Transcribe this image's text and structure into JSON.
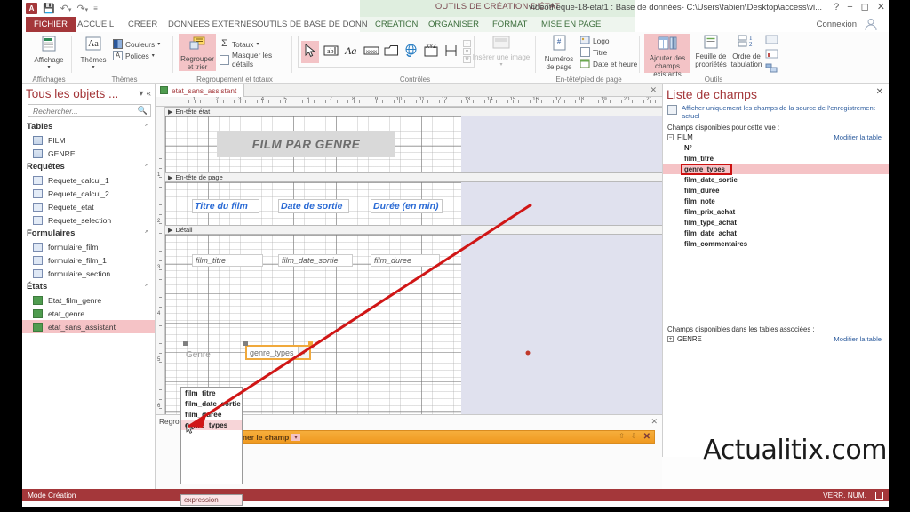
{
  "titlebar": {
    "app_icon": "access-logo",
    "qat": [
      "save-icon",
      "undo-icon",
      "redo-icon",
      "customize-qat-icon"
    ],
    "context_tab_label": "OUTILS DE CRÉATION D'ÉTAT",
    "document_title": "videotheque-18-etat1 : Base de données- C:\\Users\\fabien\\Desktop\\access\\vi...",
    "help": "?",
    "minimize": "−",
    "restore": "◻",
    "close": "✕",
    "account_label": "Connexion"
  },
  "ribbon_tabs": [
    {
      "label": "FICHIER",
      "state": "file"
    },
    {
      "label": "ACCUEIL",
      "state": "normal"
    },
    {
      "label": "CRÉER",
      "state": "normal"
    },
    {
      "label": "DONNÉES EXTERNES",
      "state": "normal"
    },
    {
      "label": "OUTILS DE BASE DE DONNÉES",
      "state": "normal"
    },
    {
      "label": "CRÉATION",
      "state": "active"
    },
    {
      "label": "ORGANISER",
      "state": "context"
    },
    {
      "label": "FORMAT",
      "state": "context"
    },
    {
      "label": "MISE EN PAGE",
      "state": "context"
    }
  ],
  "ribbon_groups": [
    {
      "name": "Affichages",
      "items": [
        {
          "label": "Affichage",
          "icon": "view-icon",
          "has_dropdown": true
        }
      ]
    },
    {
      "name": "Thèmes",
      "items": [
        {
          "label": "Thèmes",
          "icon": "themes-icon",
          "has_dropdown": true
        },
        {
          "label": "Couleurs",
          "icon": "colors-icon",
          "has_dropdown": true
        },
        {
          "label": "Polices",
          "icon": "fonts-icon",
          "has_dropdown": true
        }
      ]
    },
    {
      "name": "Regroupement et totaux",
      "items": [
        {
          "label": "Regrouper et trier",
          "icon": "group-sort-icon",
          "highlighted": true
        },
        {
          "label": "Totaux",
          "icon": "sigma-icon",
          "has_dropdown": true
        },
        {
          "label": "Masquer les détails",
          "icon": "hide-details-icon"
        }
      ]
    },
    {
      "name": "Contrôles",
      "items": [
        {
          "label": "",
          "icon": "select-pointer-icon",
          "highlighted": true
        },
        {
          "label": "",
          "icon": "textbox-icon"
        },
        {
          "label": "",
          "icon": "label-icon"
        },
        {
          "label": "",
          "icon": "button-icon"
        },
        {
          "label": "",
          "icon": "tab-control-icon"
        },
        {
          "label": "",
          "icon": "hyperlink-icon"
        },
        {
          "label": "",
          "icon": "navigation-icon"
        },
        {
          "label": "",
          "icon": "line-icon"
        },
        {
          "label": "Insérer une image",
          "icon": "insert-image-icon",
          "has_dropdown": true
        }
      ]
    },
    {
      "name": "En-tête/pied de page",
      "items": [
        {
          "label": "Numéros de page",
          "icon": "page-numbers-icon"
        },
        {
          "label": "Logo",
          "icon": "logo-icon"
        },
        {
          "label": "Titre",
          "icon": "title-icon"
        },
        {
          "label": "Date et heure",
          "icon": "date-time-icon"
        }
      ]
    },
    {
      "name": "Outils",
      "items": [
        {
          "label": "Ajouter des champs existants",
          "icon": "add-existing-fields-icon",
          "highlighted": true
        },
        {
          "label": "Feuille de propriétés",
          "icon": "property-sheet-icon"
        },
        {
          "label": "Ordre de tabulation",
          "icon": "tab-order-icon"
        },
        {
          "label": "",
          "icon": "subreport-icon"
        }
      ]
    }
  ],
  "navpane": {
    "title": "Tous les objets ...",
    "menu_icon": "dropdown-circle-icon",
    "collapse_icon": "double-chevron-left-icon",
    "search_placeholder": "Rechercher...",
    "search_value": "",
    "search_icon": "search-icon",
    "groups": [
      {
        "label": "Tables",
        "collapse_icon": "chevron-up-icon",
        "items": [
          {
            "label": "FILM",
            "icon": "table-icon",
            "selected": false
          },
          {
            "label": "GENRE",
            "icon": "table-icon",
            "selected": false
          }
        ]
      },
      {
        "label": "Requêtes",
        "collapse_icon": "chevron-up-icon",
        "items": [
          {
            "label": "Requete_calcul_1",
            "icon": "query-icon",
            "selected": false
          },
          {
            "label": "Requete_calcul_2",
            "icon": "query-icon",
            "selected": false
          },
          {
            "label": "Requete_etat",
            "icon": "query-icon",
            "selected": false
          },
          {
            "label": "Requete_selection",
            "icon": "query-icon",
            "selected": false
          }
        ]
      },
      {
        "label": "Formulaires",
        "collapse_icon": "chevron-up-icon",
        "items": [
          {
            "label": "formulaire_film",
            "icon": "form-icon",
            "selected": false
          },
          {
            "label": "formulaire_film_1",
            "icon": "form-icon",
            "selected": false
          },
          {
            "label": "formulaire_section",
            "icon": "form-icon",
            "selected": false
          }
        ]
      },
      {
        "label": "États",
        "collapse_icon": "chevron-up-icon",
        "items": [
          {
            "label": "Etat_film_genre",
            "icon": "report-icon",
            "selected": false
          },
          {
            "label": "etat_genre",
            "icon": "report-icon",
            "selected": false
          },
          {
            "label": "etat_sans_assistant",
            "icon": "report-icon",
            "selected": true
          }
        ]
      }
    ]
  },
  "design": {
    "document_tab": {
      "label": "etat_sans_assistant",
      "icon": "report-icon"
    },
    "close_icon": "✕",
    "ruler_h_max": 21,
    "ruler_v_max": 6,
    "bands": [
      {
        "label": "En-tête état",
        "marker": "band-marker-icon"
      },
      {
        "label": "En-tête de page",
        "marker": "band-marker-icon"
      },
      {
        "label": "Détail",
        "marker": "band-marker-icon"
      }
    ],
    "controls": [
      {
        "name": "report-title-label",
        "text": "FILM PAR GENRE",
        "band": "En-tête état"
      },
      {
        "name": "column-header-title",
        "text": "Titre du film",
        "band": "En-tête de page"
      },
      {
        "name": "column-header-date",
        "text": "Date de sortie",
        "band": "En-tête de page"
      },
      {
        "name": "column-header-duration",
        "text": "Durée (en min)",
        "band": "En-tête de page"
      },
      {
        "name": "field-film-titre",
        "text": "film_titre",
        "band": "Détail"
      },
      {
        "name": "field-film-date-sortie",
        "text": "film_date_sortie",
        "band": "Détail"
      },
      {
        "name": "field-film-duree",
        "text": "film_duree",
        "band": "Détail"
      },
      {
        "name": "label-genre",
        "text": "Genre",
        "band": "Détail"
      },
      {
        "name": "combo-genre-types",
        "text": "genre_types",
        "band": "Détail",
        "selected": true,
        "dropdown_icon": "chevron-down-icon"
      }
    ]
  },
  "group_sort_pane": {
    "title": "Regrouper, trier et total",
    "close_icon": "✕",
    "bar_label": "sélectionner le champ",
    "bar_dropdown_icon": "chevron-down-icon",
    "tools": [
      "move-up-icon",
      "move-down-icon",
      "delete-icon"
    ],
    "accent_color": "#f09a20"
  },
  "field_list": {
    "title": "Liste de champs",
    "close_icon": "✕",
    "filter_option": "Afficher uniquement les champs de la source de l'enregistrement actuel",
    "filter_icon": "filter-fields-icon",
    "available_label": "Champs disponibles pour cette vue :",
    "table_name": "FILM",
    "table_expander": "−",
    "edit_table_link": "Modifier la table",
    "fields": [
      {
        "label": "N°",
        "selected": false
      },
      {
        "label": "film_titre",
        "selected": false
      },
      {
        "label": "genre_types",
        "selected": true
      },
      {
        "label": "film_date_sortie",
        "selected": false
      },
      {
        "label": "film_duree",
        "selected": false
      },
      {
        "label": "film_note",
        "selected": false
      },
      {
        "label": "film_prix_achat",
        "selected": false
      },
      {
        "label": "film_type_achat",
        "selected": false
      },
      {
        "label": "film_date_achat",
        "selected": false
      },
      {
        "label": "film_commentaires",
        "selected": false
      }
    ],
    "related_label": "Champs disponibles dans les tables associées :",
    "related_table": "GENRE",
    "related_expander": "+",
    "related_edit_link": "Modifier la table"
  },
  "expression_dropdown": {
    "items": [
      {
        "label": "film_titre",
        "selected": false
      },
      {
        "label": "film_date_sortie",
        "selected": false
      },
      {
        "label": "film_duree",
        "selected": false
      },
      {
        "label": "genre_types",
        "selected": true
      }
    ],
    "footer_label": "expression"
  },
  "statusbar": {
    "mode": "Mode Création",
    "numlock": "VERR. NUM.",
    "view_icon": "design-view-icon"
  },
  "watermark": "Actualitix.com",
  "colors": {
    "accent": "#a4373a",
    "selection": "#f5c3c6",
    "orange": "#f09a20",
    "annotation": "#d01616",
    "link": "#2e5d9e",
    "header_blue": "#2a6ad4"
  }
}
